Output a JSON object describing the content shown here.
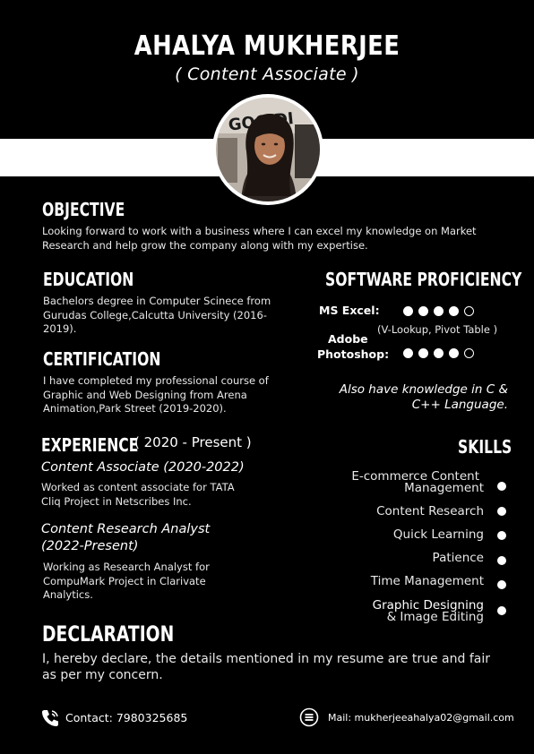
{
  "header": {
    "name": "AHALYA MUKHERJEE",
    "role": "( Content Associate )"
  },
  "objective": {
    "title": "OBJECTIVE",
    "text": "Looking forward to work with a business where I can excel my knowledge on Market Research and help grow the company along with my expertise."
  },
  "education": {
    "title": "EDUCATION",
    "text": "Bachelors degree in Computer Scinece from Gurudas College,Calcutta University (2016-2019)."
  },
  "certification": {
    "title": "CERTIFICATION",
    "text": "I have completed my professional course of Graphic and Web Designing from Arena Animation,Park Street (2019-2020)."
  },
  "software": {
    "title": "SOFTWARE PROFICIENCY",
    "items": [
      {
        "label": "MS Excel:",
        "note": "(V-Lookup, Pivot Table )",
        "rating": 4,
        "max": 5
      },
      {
        "label_line1": "Adobe",
        "label_line2": "Photoshop:",
        "rating": 4,
        "max": 5
      }
    ],
    "extra_line1": "Also have knowledge in C &",
    "extra_line2": "C++ Language."
  },
  "experience": {
    "title": "EXPERIENCE",
    "period": "( 2020 - Present )",
    "jobs": [
      {
        "role": "Content Associate (2020-2022)",
        "desc": "Worked as content associate for TATA Cliq Project in Netscribes Inc."
      },
      {
        "role_line1": "Content Research Analyst",
        "role_line2": "(2022-Present)",
        "desc": "Working as Research Analyst for CompuMark Project in Clarivate Analytics."
      }
    ]
  },
  "skills": {
    "title": "SKILLS",
    "items": [
      {
        "line1": "E-commerce Content",
        "line2": "Management"
      },
      {
        "line1": "Content Research"
      },
      {
        "line1": "Quick Learning"
      },
      {
        "line1": "Patience"
      },
      {
        "line1": "Time Management"
      },
      {
        "line1": "Graphic Designing",
        "line2": "& Image Editing"
      }
    ]
  },
  "declaration": {
    "title": "DECLARATION",
    "text": "I, hereby declare, the details mentioned in my resume are true and fair as per my concern."
  },
  "footer": {
    "contact": "Contact: 7980325685",
    "mail": "Mail: mukherjeeahalya02@gmail.com",
    "phone_icon": "phone-icon",
    "mail_icon": "mail-icon"
  }
}
